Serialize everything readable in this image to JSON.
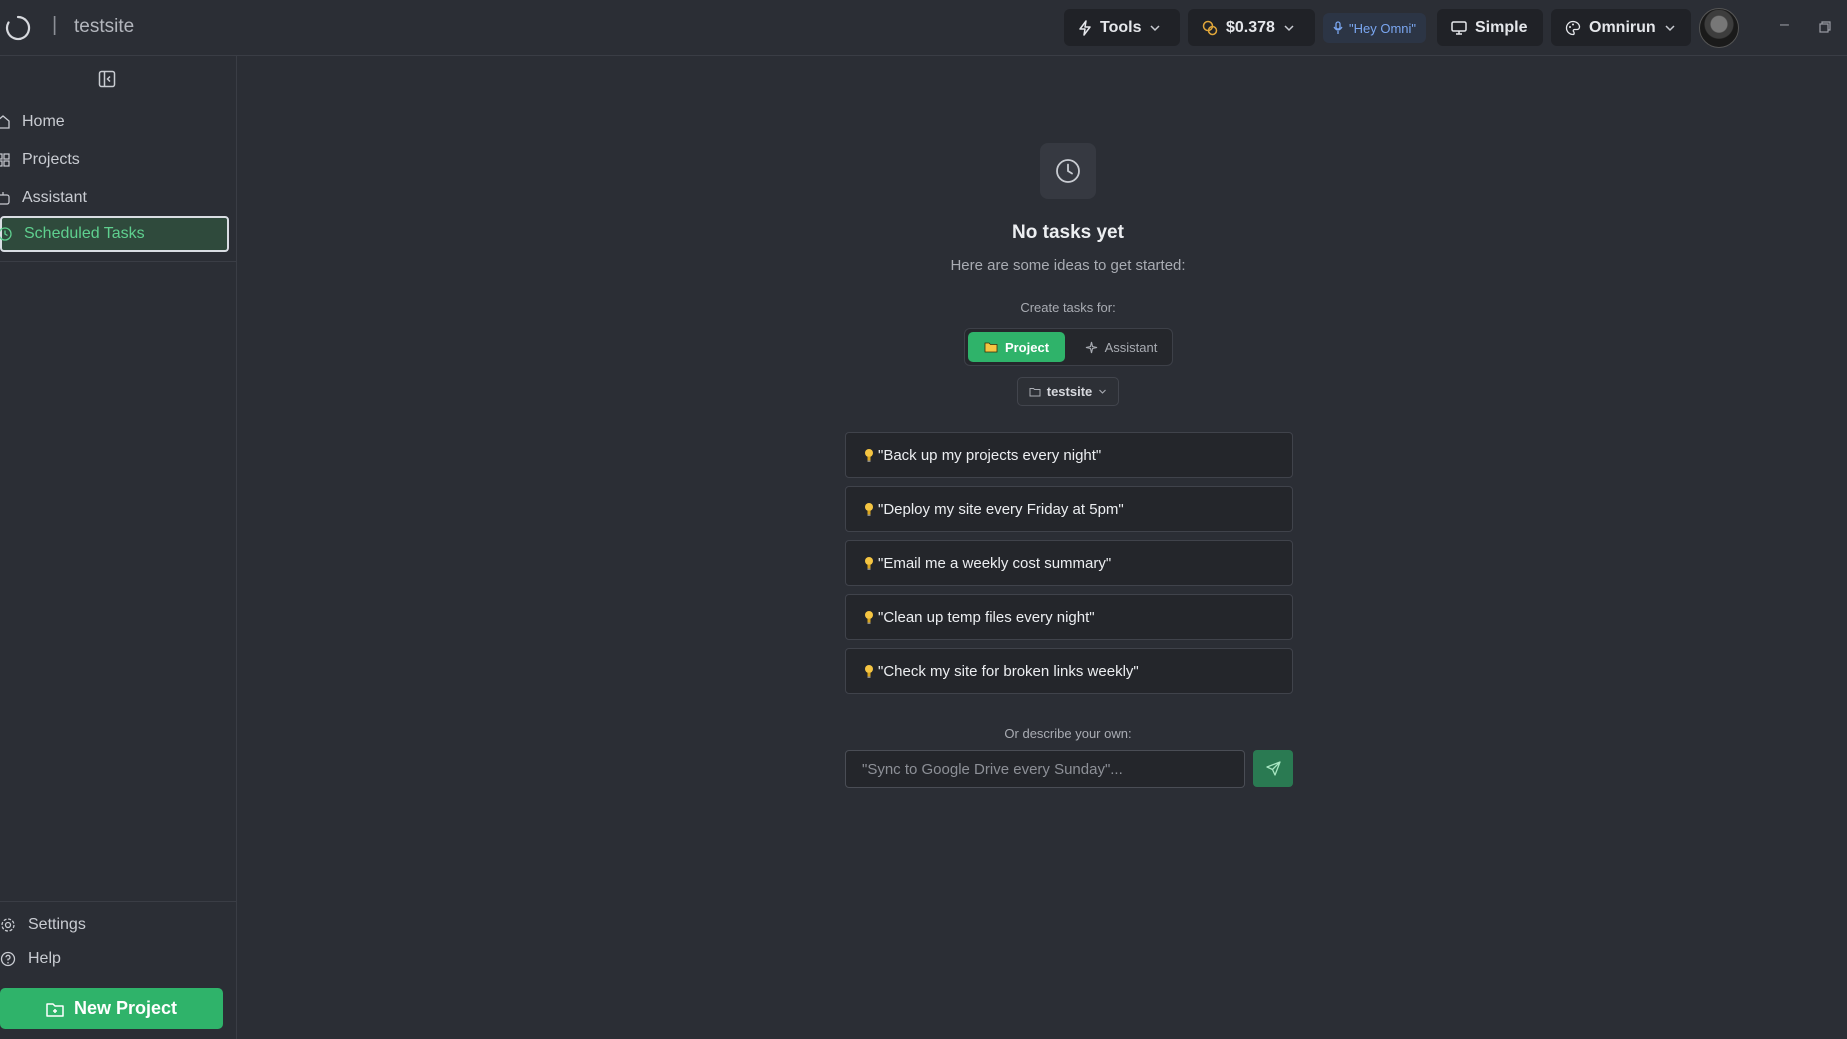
{
  "header": {
    "title_separator": "|",
    "app_title": "testsite",
    "tools_label": "Tools",
    "cost_label": "$0.378",
    "voice_label": "\"Hey Omni\"",
    "mode_label": "Simple",
    "theme_label": "Omnirun"
  },
  "sidebar": {
    "items": [
      {
        "label": "Home"
      },
      {
        "label": "Projects"
      },
      {
        "label": "Assistant"
      },
      {
        "label": "Scheduled Tasks"
      }
    ],
    "settings_label": "Settings",
    "help_label": "Help",
    "new_project_label": "New Project"
  },
  "main": {
    "empty_title": "No tasks yet",
    "empty_subtitle": "Here are some ideas to get started:",
    "create_label": "Create tasks for:",
    "segment_project": "Project",
    "segment_assistant": "Assistant",
    "selected_project": "testsite",
    "ideas": [
      "\"Back up my projects every night\"",
      "\"Deploy my site every Friday at 5pm\"",
      "\"Email me a weekly cost summary\"",
      "\"Clean up temp files every night\"",
      "\"Check my site for broken links weekly\""
    ],
    "or_label": "Or describe your own:",
    "input_placeholder": "\"Sync to Google Drive every Sunday\"..."
  },
  "colors": {
    "background": "#2b2e35",
    "accent_green": "#2fb36a",
    "active_text": "#5fd08f",
    "voice_blue": "#7aa6f0"
  }
}
